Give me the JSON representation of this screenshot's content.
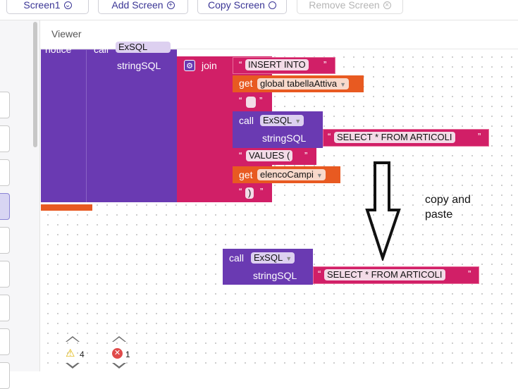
{
  "toolbar": {
    "screen_select": "Screen1",
    "add_screen": "Add Screen",
    "copy_screen": "Copy Screen",
    "remove_screen": "Remove Screen"
  },
  "viewer": {
    "title": "Viewer"
  },
  "blocks": {
    "partial_notice": "notice",
    "partial_call": "call",
    "partial_component": "ExSQL",
    "string_sql": "stringSQL",
    "join": "join",
    "insert_into": "INSERT INTO",
    "get": "get",
    "global_var": "global tabellaAttiva",
    "call": "call",
    "exsql": "ExSQL",
    "select_text": "SELECT * FROM ARTICOLI",
    "values_text": "VALUES (",
    "elenco_campi": "elencoCampi",
    "close_paren": ")",
    "quote_open": "“",
    "quote_close": "”"
  },
  "annotation": {
    "line1": "copy and",
    "line2": "paste"
  },
  "workspace_controls": {
    "warnings": "4",
    "errors": "1"
  },
  "colors": {
    "procedure": "#6a3ab2",
    "text": "#d11f67",
    "variable": "#e85a21",
    "accent": "#3a3595"
  }
}
